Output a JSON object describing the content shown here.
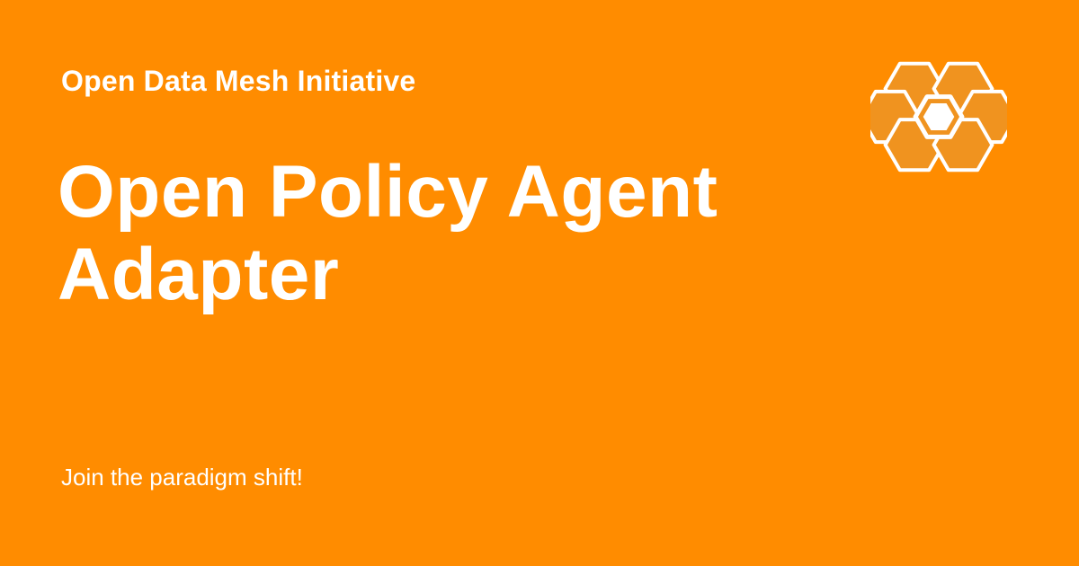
{
  "site": {
    "name": "Open Data Mesh Initiative"
  },
  "page": {
    "title_lines": [
      "Open Policy Agent",
      "Adapter"
    ],
    "tagline": "Join the paradigm shift!"
  },
  "logo": {
    "icon": "honeycomb-logo-icon",
    "hex_fill": "#f0931f",
    "stroke": "#ffffff",
    "center_fill": "#ffffff"
  },
  "colors": {
    "background": "#ff8c00",
    "text": "#ffffff"
  }
}
